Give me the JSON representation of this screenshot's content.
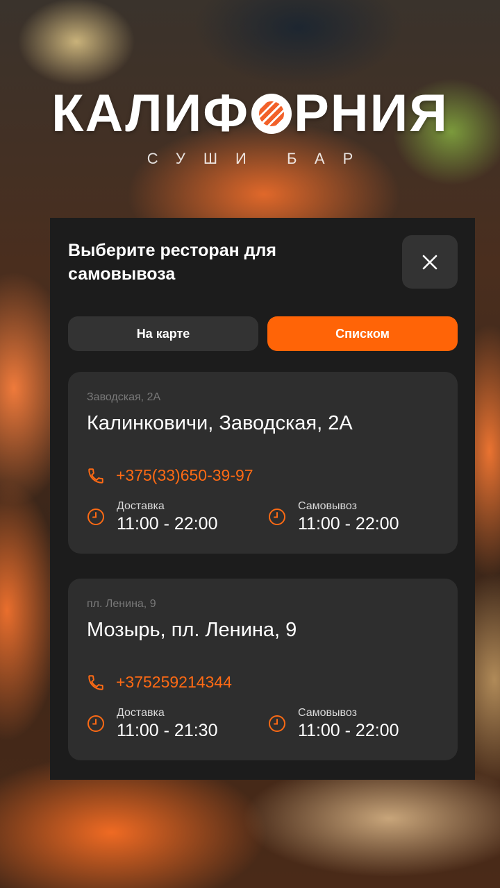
{
  "brand": {
    "title_before": "КАЛИФ",
    "title_after": "РНИЯ",
    "subtitle": "СУШИ БАР"
  },
  "modal": {
    "title": "Выберите ресторан для самовывоза",
    "close_icon": "close-icon",
    "tabs": [
      {
        "label": "На карте",
        "active": false
      },
      {
        "label": "Списком",
        "active": true
      }
    ]
  },
  "restaurants": [
    {
      "street": "Заводская, 2А",
      "name": "Калинковичи, Заводская, 2А",
      "phone": "+375(33)650-39-97",
      "delivery": {
        "label": "Доставка",
        "hours": "11:00 - 22:00"
      },
      "pickup": {
        "label": "Самовывоз",
        "hours": "11:00 - 22:00"
      }
    },
    {
      "street": "пл. Ленина, 9",
      "name": "Мозырь, пл. Ленина, 9",
      "phone": "+375259214344",
      "delivery": {
        "label": "Доставка",
        "hours": "11:00 - 21:30"
      },
      "pickup": {
        "label": "Самовывоз",
        "hours": "11:00 - 22:00"
      }
    }
  ],
  "colors": {
    "accent": "#ff6407",
    "sheet_bg": "#1c1c1c",
    "card_bg": "#2e2e2e"
  }
}
